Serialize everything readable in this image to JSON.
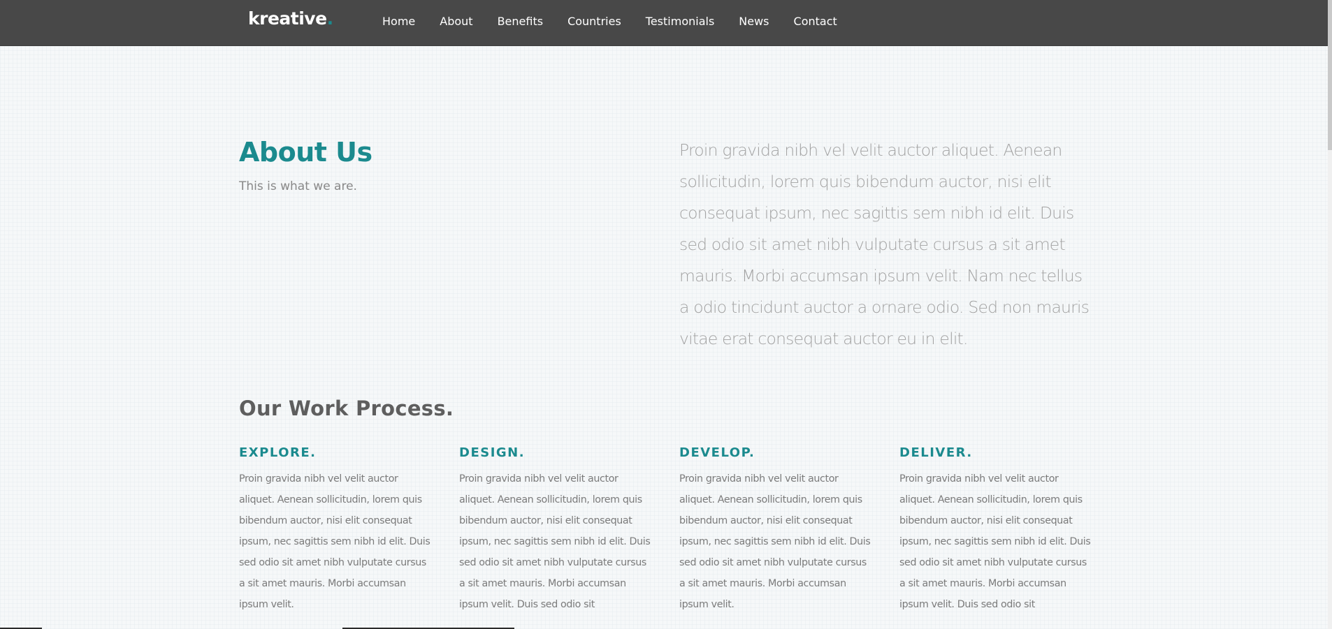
{
  "header": {
    "logo_text": "kreative",
    "logo_dot": ".",
    "nav": [
      "Home",
      "About",
      "Benefits",
      "Countries",
      "Testimonials",
      "News",
      "Contact"
    ]
  },
  "about": {
    "title": "About Us",
    "subtitle": "This is what we are.",
    "body": "Proin gravida nibh vel velit auctor aliquet. Aenean sollicitudin, lorem quis bibendum auctor, nisi elit consequat ipsum, nec sagittis sem nibh id elit. Duis sed odio sit amet nibh vulputate cursus a sit amet mauris. Morbi accumsan ipsum velit. Nam nec tellus a odio tincidunt auctor a ornare odio. Sed non mauris vitae erat consequat auctor eu in elit."
  },
  "process": {
    "title": "Our Work Process.",
    "steps": [
      {
        "heading": "EXPLORE.",
        "text": "Proin gravida nibh vel velit auctor aliquet. Aenean sollicitudin, lorem quis bibendum auctor, nisi elit consequat ipsum, nec sagittis sem nibh id elit. Duis sed odio sit amet nibh vulputate cursus a sit amet mauris. Morbi accumsan ipsum velit."
      },
      {
        "heading": "DESIGN.",
        "text": "Proin gravida nibh vel velit auctor aliquet. Aenean sollicitudin, lorem quis bibendum auctor, nisi elit consequat ipsum, nec sagittis sem nibh id elit. Duis sed odio sit amet nibh vulputate cursus a sit amet mauris. Morbi accumsan ipsum velit. Duis sed odio sit"
      },
      {
        "heading": "DEVELOP.",
        "text": "Proin gravida nibh vel velit auctor aliquet. Aenean sollicitudin, lorem quis bibendum auctor, nisi elit consequat ipsum, nec sagittis sem nibh id elit. Duis sed odio sit amet nibh vulputate cursus a sit amet mauris. Morbi accumsan ipsum velit."
      },
      {
        "heading": "DELIVER.",
        "text": "Proin gravida nibh vel velit auctor aliquet. Aenean sollicitudin, lorem quis bibendum auctor, nisi elit consequat ipsum, nec sagittis sem nibh id elit. Duis sed odio sit amet nibh vulputate cursus a sit amet mauris. Morbi accumsan ipsum velit. Duis sed odio sit"
      }
    ]
  },
  "colors": {
    "accent": "#1b8a8e",
    "header_bg": "#484848",
    "page_bg": "#f6f8f9"
  }
}
